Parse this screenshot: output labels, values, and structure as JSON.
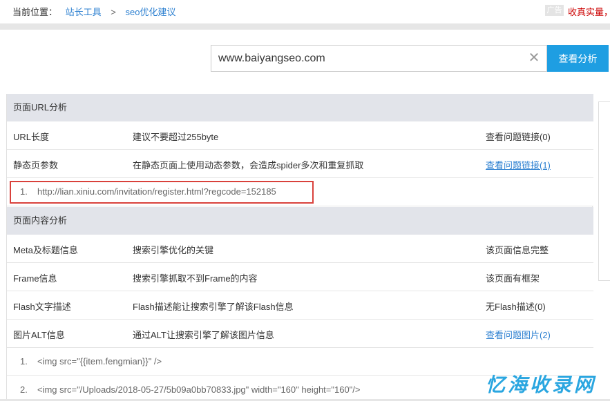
{
  "breadcrumb": {
    "prefix": "当前位置：",
    "home": "站长工具",
    "separator": ">",
    "current": "seo优化建议"
  },
  "ad": {
    "badge": "广告",
    "text": "收真实量，"
  },
  "search": {
    "value": "www.baiyangseo.com",
    "clear_symbol": "✕",
    "button_label": "查看分析"
  },
  "url_section": {
    "title": "页面URL分析",
    "rows": [
      {
        "name": "URL长度",
        "desc": "建议不要超过255byte",
        "status": "查看问题链接(0)"
      },
      {
        "name": "静态页参数",
        "desc": "在静态页面上使用动态参数，会造成spider多次和重复抓取",
        "status": "查看问题链接(1)"
      }
    ],
    "items": [
      {
        "num": "1.",
        "text": "http://lian.xiniu.com/invitation/register.html?regcode=152185"
      }
    ]
  },
  "content_section": {
    "title": "页面内容分析",
    "rows": [
      {
        "name": "Meta及标题信息",
        "desc": "搜索引擎优化的关键",
        "status": "该页面信息完整"
      },
      {
        "name": "Frame信息",
        "desc": "搜索引擎抓取不到Frame的内容",
        "status": "该页面有框架"
      },
      {
        "name": "Flash文字描述",
        "desc": "Flash描述能让搜索引擎了解该Flash信息",
        "status": "无Flash描述(0)"
      },
      {
        "name": "图片ALT信息",
        "desc": "通过ALT让搜索引擎了解该图片信息",
        "status": "查看问题图片(2)"
      }
    ],
    "items": [
      {
        "num": "1.",
        "text": "<img src=\"{{item.fengmian}}\" />"
      },
      {
        "num": "2.",
        "text": "<img src=\"/Uploads/2018-05-27/5b09a0bb70833.jpg\" width=\"160\" height=\"160\"/>"
      }
    ]
  },
  "watermark": "忆海收录网",
  "colors": {
    "accent": "#1e9ee2",
    "link": "#2b7fd0",
    "header_bg": "#e2e4ea",
    "highlight_border": "#d9413b",
    "ad_text": "#cc0000"
  }
}
